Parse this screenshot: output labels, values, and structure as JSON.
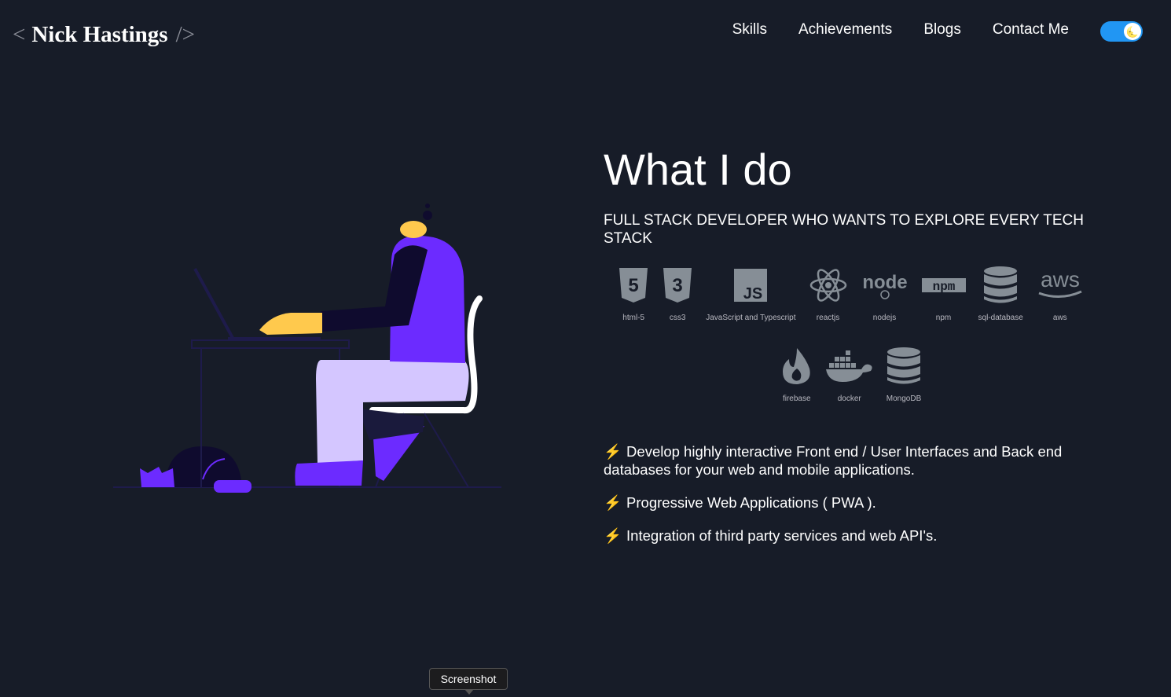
{
  "header": {
    "logo": {
      "open": "<",
      "name": "Nick Hastings",
      "close": "/>"
    },
    "nav": [
      "Skills",
      "Achievements",
      "Blogs",
      "Contact Me"
    ],
    "theme_toggle": {
      "state": "on",
      "knob_icon": "moon-emoji"
    }
  },
  "section": {
    "title": "What I do",
    "subtitle": "FULL STACK DEVELOPER WHO WANTS TO EXPLORE EVERY TECH STACK",
    "skills": [
      {
        "label": "html-5",
        "icon": "html5-icon"
      },
      {
        "label": "css3",
        "icon": "css3-icon"
      },
      {
        "label": "JavaScript and Typescript",
        "icon": "js-icon"
      },
      {
        "label": "reactjs",
        "icon": "react-icon"
      },
      {
        "label": "nodejs",
        "icon": "node-icon"
      },
      {
        "label": "npm",
        "icon": "npm-icon"
      },
      {
        "label": "sql-database",
        "icon": "database-icon"
      },
      {
        "label": "aws",
        "icon": "aws-icon"
      },
      {
        "label": "firebase",
        "icon": "firebase-icon"
      },
      {
        "label": "docker",
        "icon": "docker-icon"
      },
      {
        "label": "MongoDB",
        "icon": "database-icon"
      }
    ],
    "bullets": [
      "Develop highly interactive Front end / User Interfaces and Back end databases for your web and mobile applications.",
      "Progressive Web Applications ( PWA ).",
      "Integration of third party services and web API's."
    ],
    "bullet_icon": "⚡"
  },
  "tooltip": {
    "text": "Screenshot"
  },
  "colors": {
    "background": "#171c28",
    "accent_purple": "#6c2bff",
    "toggle_blue": "#2196f3",
    "icon_gray": "#868e96"
  }
}
